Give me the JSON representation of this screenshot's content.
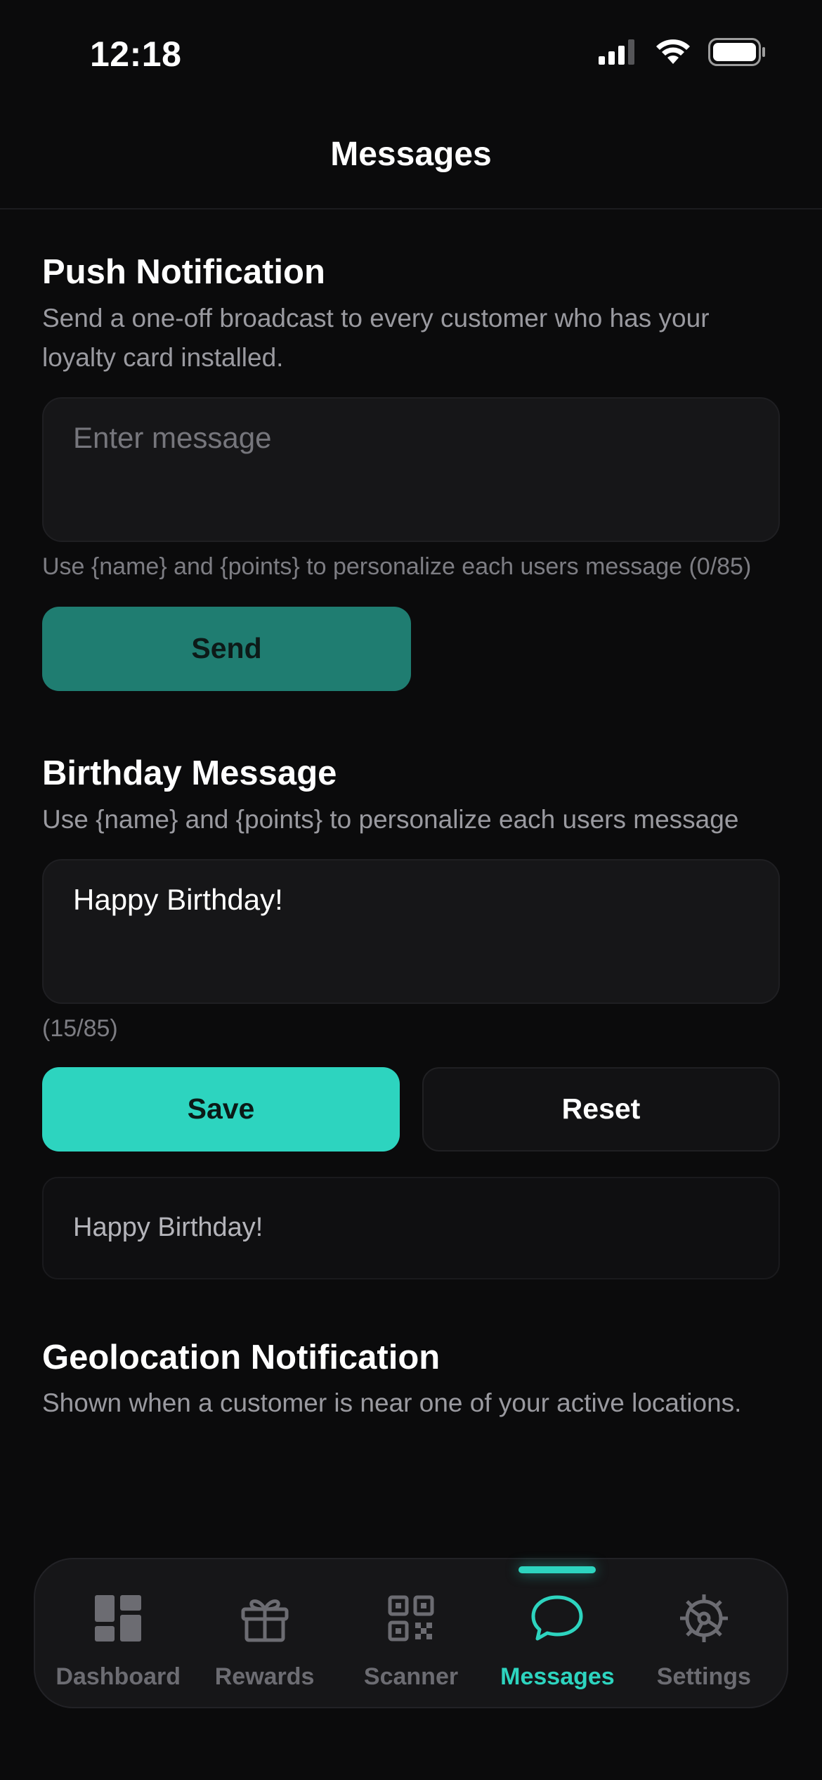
{
  "status_bar": {
    "time": "12:18",
    "icons": [
      "cellular-signal-icon",
      "wifi-icon",
      "battery-icon"
    ]
  },
  "header": {
    "title": "Messages"
  },
  "push": {
    "title": "Push Notification",
    "description": "Send a one-off broadcast to every customer who has your loyalty card installed.",
    "placeholder": "Enter message",
    "helper": "Use {name} and {points} to personalize each users message (0/85)",
    "send_label": "Send"
  },
  "birthday": {
    "title": "Birthday Message",
    "description": "Use {name} and {points} to personalize each users message",
    "value": "Happy Birthday!",
    "counter": "(15/85)",
    "save_label": "Save",
    "reset_label": "Reset",
    "preview": "Happy Birthday!"
  },
  "geo": {
    "title": "Geolocation Notification",
    "description": "Shown when a customer is near one of your active locations."
  },
  "tabs": [
    {
      "label": "Dashboard",
      "icon": "dashboard-icon",
      "active": false
    },
    {
      "label": "Rewards",
      "icon": "gift-icon",
      "active": false
    },
    {
      "label": "Scanner",
      "icon": "qr-code-icon",
      "active": false
    },
    {
      "label": "Messages",
      "icon": "chat-bubble-icon",
      "active": true
    },
    {
      "label": "Settings",
      "icon": "gear-icon",
      "active": false
    }
  ],
  "colors": {
    "background": "#0b0b0c",
    "accent": "#2dd4bf",
    "send_button": "#1f7d71",
    "inactive_tab": "#6c6c72"
  }
}
